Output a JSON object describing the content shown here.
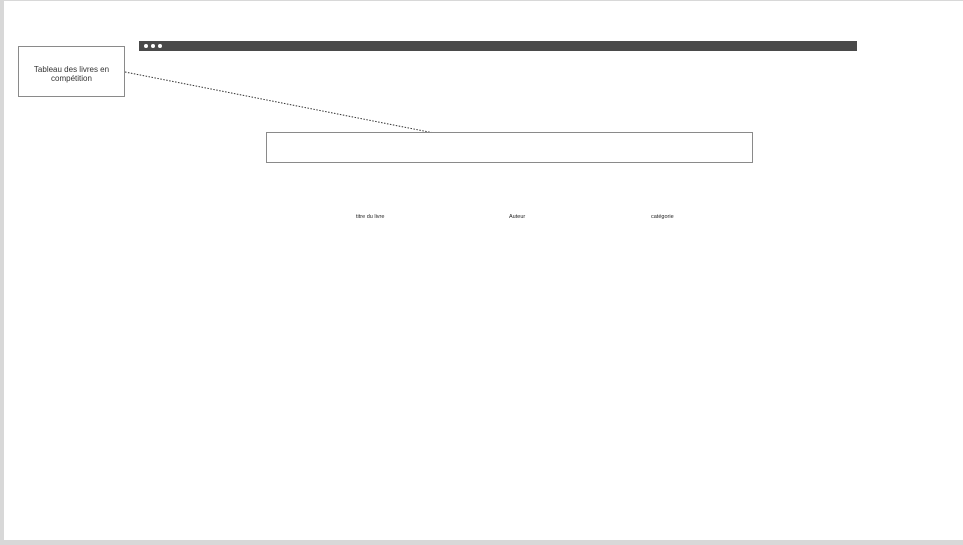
{
  "annotation": {
    "text": "Tableau des livres en compétition"
  },
  "browser_bar": {
    "dots_icon": "three-dots-icon"
  },
  "table": {
    "columns": [
      "titre du livre",
      "Auteur",
      "catégorie"
    ]
  },
  "colors": {
    "bar": "#4a4a4a",
    "border": "#8a8a8a",
    "background": "#ffffff"
  }
}
